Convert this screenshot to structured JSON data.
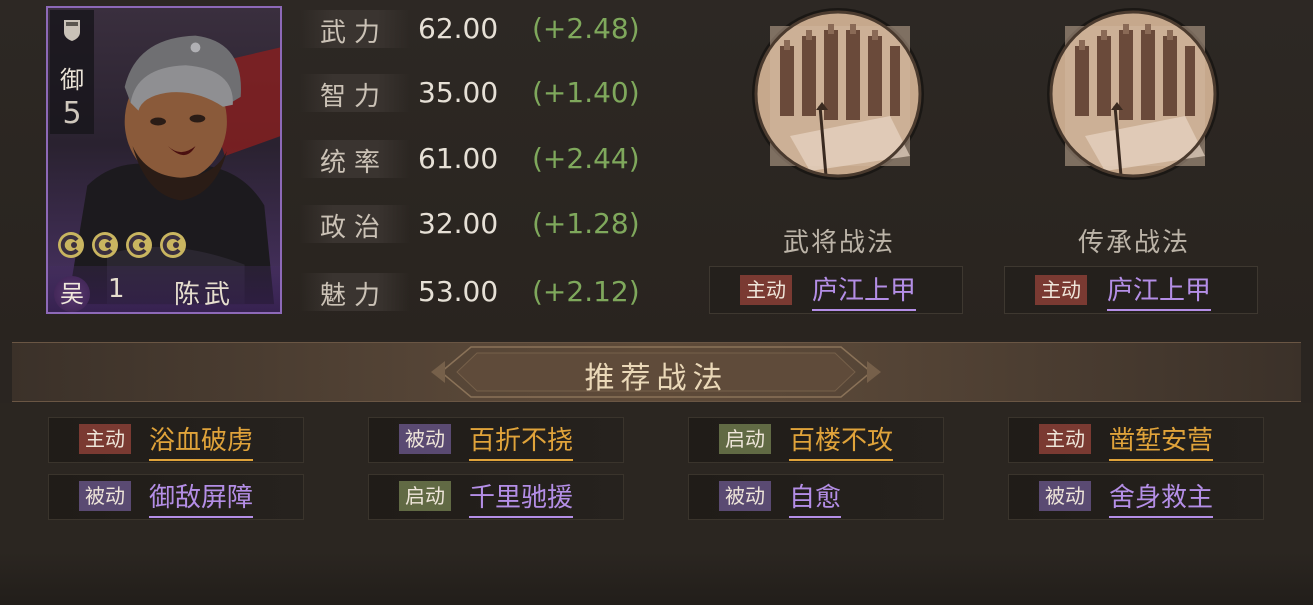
{
  "general": {
    "troop_type": "御",
    "troop_level": "5",
    "faction": "吴",
    "level": "1",
    "name": "陈武",
    "stars": 4
  },
  "stats": [
    {
      "label": "武力",
      "value": "62.00",
      "bonus": "(+2.48)"
    },
    {
      "label": "智力",
      "value": "35.00",
      "bonus": "(+1.40)"
    },
    {
      "label": "统率",
      "value": "61.00",
      "bonus": "(+2.44)"
    },
    {
      "label": "政治",
      "value": "32.00",
      "bonus": "(+1.28)"
    },
    {
      "label": "魅力",
      "value": "53.00",
      "bonus": "(+2.12)"
    }
  ],
  "skills": {
    "general_skill": {
      "caption": "武将战法",
      "tag": "主动",
      "name": "庐江上甲"
    },
    "inherit_skill": {
      "caption": "传承战法",
      "tag": "主动",
      "name": "庐江上甲"
    }
  },
  "recommended": {
    "title": "推荐战法",
    "items": [
      {
        "tag": "主动",
        "name": "浴血破虏"
      },
      {
        "tag": "被动",
        "name": "百折不挠"
      },
      {
        "tag": "启动",
        "name": "百楼不攻"
      },
      {
        "tag": "主动",
        "name": "凿堑安营"
      },
      {
        "tag": "被动",
        "name": "御敌屏障"
      },
      {
        "tag": "启动",
        "name": "千里驰援"
      },
      {
        "tag": "被动",
        "name": "自愈"
      },
      {
        "tag": "被动",
        "name": "舍身救主"
      }
    ]
  },
  "colors": {
    "active_tag": "#7a3a32",
    "passive_tag": "#5a4a72",
    "trigger_tag": "#616a44",
    "bonus_green": "#7fa85c",
    "name_orange": "#e0a33a",
    "name_purple": "#b48ee6"
  }
}
